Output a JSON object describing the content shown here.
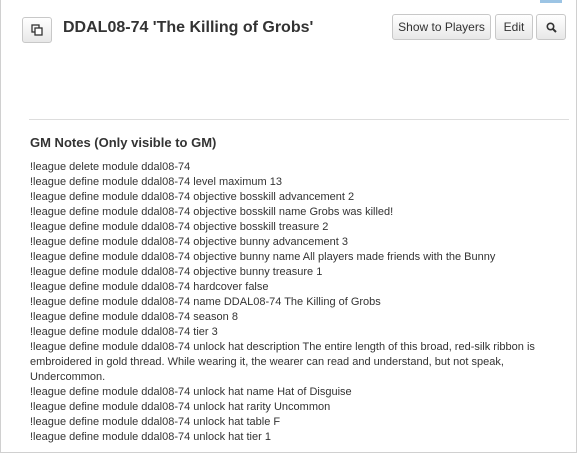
{
  "header": {
    "popout_icon": "popout-icon",
    "title": "DDAL08-74 'The Killing of Grobs'",
    "show_to_players_label": "Show to Players",
    "edit_label": "Edit",
    "search_icon": "search-icon"
  },
  "gm_notes": {
    "heading": "GM Notes (Only visible to GM)",
    "lines": [
      "!league delete module ddal08-74",
      "!league define module ddal08-74 level maximum 13",
      "!league define module ddal08-74 objective bosskill advancement 2",
      "!league define module ddal08-74 objective bosskill name Grobs was killed!",
      "!league define module ddal08-74 objective bosskill treasure 2",
      "!league define module ddal08-74 objective bunny advancement 3",
      "!league define module ddal08-74 objective bunny name All players made friends with the Bunny",
      "!league define module ddal08-74 objective bunny treasure 1",
      "!league define module ddal08-74 hardcover false",
      "!league define module ddal08-74 name DDAL08-74 The Killing of Grobs",
      "!league define module ddal08-74 season 8",
      "!league define module ddal08-74 tier 3",
      "!league define module ddal08-74 unlock hat description The entire length of this broad, red-silk ribbon is embroidered in gold thread. While wearing it, the wearer can read and understand, but not speak, Undercommon.",
      "!league define module ddal08-74 unlock hat name Hat of Disguise",
      "!league define module ddal08-74 unlock hat rarity Uncommon",
      "!league define module ddal08-74 unlock hat table F",
      "!league define module ddal08-74 unlock hat tier 1"
    ]
  }
}
